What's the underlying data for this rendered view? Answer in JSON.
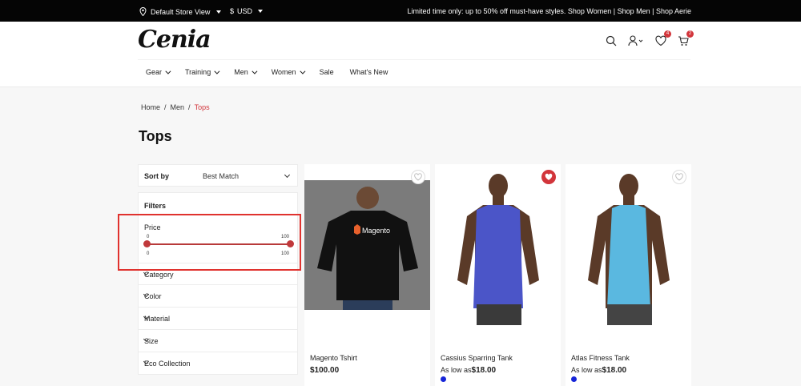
{
  "topbar": {
    "store_label": "Default Store View",
    "currency_label": "USD",
    "currency_symbol": "$",
    "promo_text": "Limited time only: up to 50% off must-have styles. Shop Women | Shop Men | Shop Aerie"
  },
  "header": {
    "logo": "Cenia",
    "wishlist_count": "4",
    "cart_count": "2",
    "nav": [
      {
        "label": "Gear",
        "has_dropdown": true
      },
      {
        "label": "Training",
        "has_dropdown": true
      },
      {
        "label": "Men",
        "has_dropdown": true
      },
      {
        "label": "Women",
        "has_dropdown": true
      },
      {
        "label": "Sale",
        "has_dropdown": false
      },
      {
        "label": "What's New",
        "has_dropdown": false
      }
    ]
  },
  "breadcrumb": {
    "items": [
      "Home",
      "Men",
      "Tops"
    ],
    "separator": "/"
  },
  "page_title": "Tops",
  "sidebar": {
    "sort_label": "Sort by",
    "sort_value": "Best Match",
    "filters_label": "Filters",
    "price": {
      "label": "Price",
      "min_label": "0",
      "max_label": "100",
      "min_value": "0",
      "max_value": "100"
    },
    "filters": [
      "Category",
      "Color",
      "Material",
      "Size",
      "Eco Collection"
    ]
  },
  "products": [
    {
      "name": "Magento Tshirt",
      "price_prefix": "",
      "price": "$100.00",
      "wishlisted": false,
      "has_swatch": false,
      "shirt_color": "#111111",
      "shirt_logo": "Magento"
    },
    {
      "name": "Cassius Sparring Tank",
      "price_prefix": "As low as",
      "price": "$18.00",
      "wishlisted": true,
      "has_swatch": true,
      "shirt_color": "#4b55c8"
    },
    {
      "name": "Atlas Fitness Tank",
      "price_prefix": "As low as",
      "price": "$18.00",
      "wishlisted": false,
      "has_swatch": true,
      "shirt_color": "#5ab8e0"
    }
  ],
  "colors": {
    "accent": "#d2353b",
    "highlight": "#e0322e",
    "swatch": "#1625d8"
  }
}
